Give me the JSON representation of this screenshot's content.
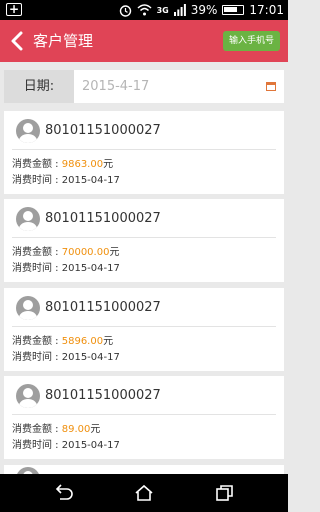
{
  "status_bar": {
    "network": "3G",
    "battery": "39%",
    "time": "17:01"
  },
  "nav": {
    "title": "客户管理",
    "phone_button": "输入手机号"
  },
  "date_filter": {
    "label": "日期:",
    "value": "2015-4-17"
  },
  "labels": {
    "amount": "消费金额 : ",
    "time": "消费时间 : ",
    "currency": "元"
  },
  "records": [
    {
      "id": "80101151000027",
      "amount": "9863.00",
      "time": "2015-04-17"
    },
    {
      "id": "80101151000027",
      "amount": "70000.00",
      "time": "2015-04-17"
    },
    {
      "id": "80101151000027",
      "amount": "5896.00",
      "time": "2015-04-17"
    },
    {
      "id": "80101151000027",
      "amount": "89.00",
      "time": "2015-04-17"
    }
  ],
  "colors": {
    "nav": "#e04456",
    "button": "#6bb343",
    "amount": "#f0900e"
  },
  "icons": [
    "notification-plus-icon",
    "alarm-icon",
    "wifi-icon",
    "signal-icon",
    "battery-icon",
    "back-icon",
    "calendar-icon",
    "avatar-icon",
    "back-nav-icon",
    "home-icon",
    "recents-icon"
  ]
}
